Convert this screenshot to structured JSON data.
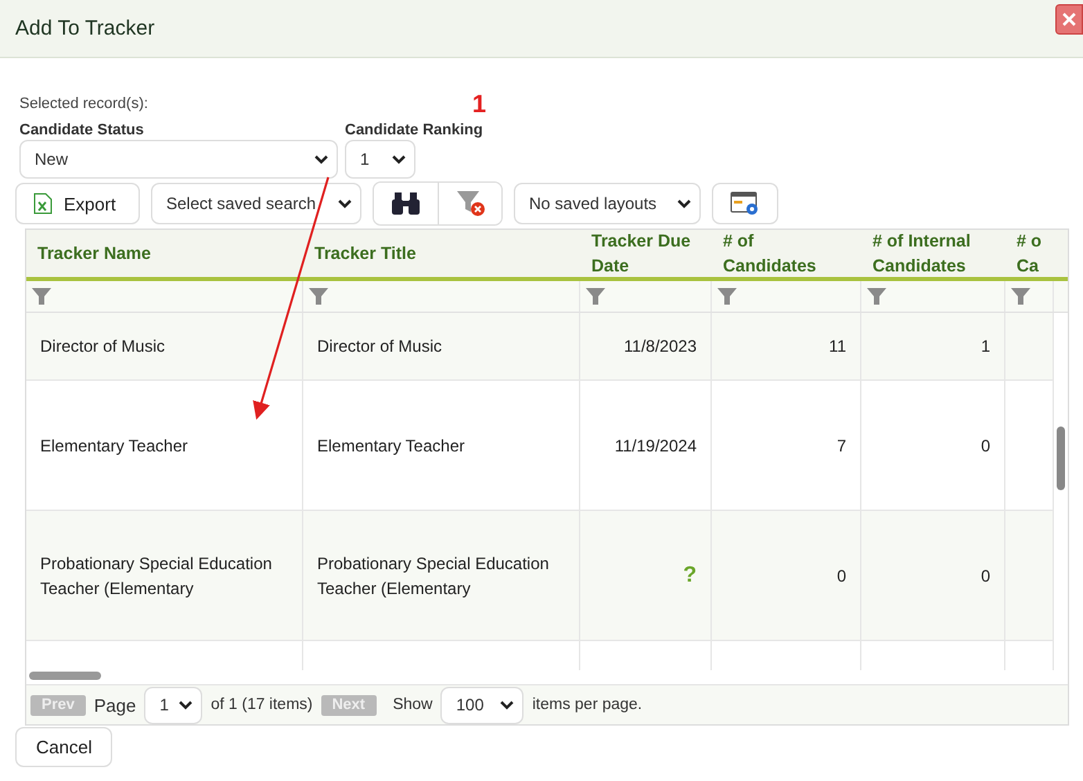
{
  "window": {
    "title": "Add To Tracker"
  },
  "selected_records": {
    "label": "Selected record(s):",
    "value": "1"
  },
  "candidate_status": {
    "label": "Candidate Status",
    "value": "New"
  },
  "candidate_ranking": {
    "label": "Candidate Ranking",
    "value": "1"
  },
  "toolbar": {
    "export": "Export",
    "saved_search": "Select saved search",
    "layouts": "No saved layouts"
  },
  "table": {
    "columns": [
      "Tracker Name",
      "Tracker Title",
      "Tracker Due Date",
      "# of Candidates",
      "# of Internal Candidates",
      "# o Ca"
    ],
    "rows": [
      {
        "cells": [
          "Director of Music",
          "Director of Music",
          "11/8/2023",
          "11",
          "1",
          ""
        ]
      },
      {
        "cells": [
          "Elementary Teacher",
          "Elementary Teacher",
          "11/19/2024",
          "7",
          "0",
          ""
        ]
      },
      {
        "cells": [
          "Probationary Special Education Teacher (Elementary",
          "Probationary Special Education Teacher (Elementary",
          "?",
          "0",
          "0",
          ""
        ]
      },
      {
        "cells": [
          "",
          "",
          "",
          "",
          "",
          ""
        ]
      }
    ]
  },
  "pager": {
    "prev": "Prev",
    "page_label": "Page",
    "page": "1",
    "of": "of 1 (17 items)",
    "next": "Next",
    "show": "Show",
    "per_page": "100",
    "suffix": "items per page."
  },
  "buttons": {
    "cancel": "Cancel"
  }
}
